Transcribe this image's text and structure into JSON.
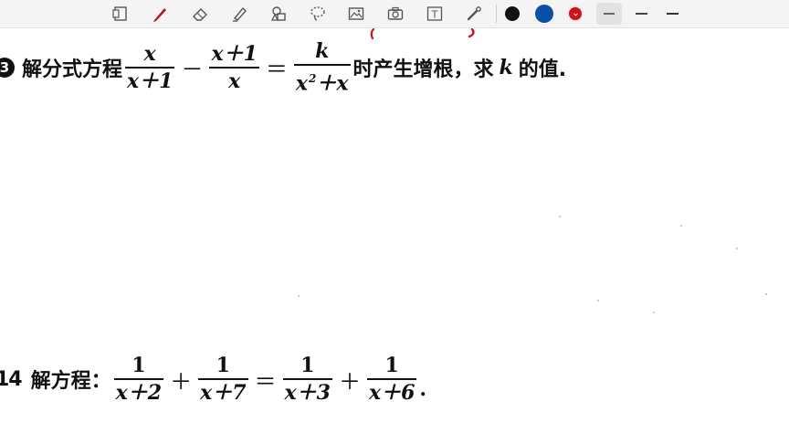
{
  "toolbar": {
    "tools": [
      {
        "name": "page-icon"
      },
      {
        "name": "pen-icon"
      },
      {
        "name": "eraser-icon"
      },
      {
        "name": "highlighter-icon"
      },
      {
        "name": "shapes-icon"
      },
      {
        "name": "lasso-icon"
      },
      {
        "name": "image-icon"
      },
      {
        "name": "camera-icon"
      },
      {
        "name": "text-icon"
      },
      {
        "name": "laser-pointer-icon"
      }
    ],
    "colors": [
      "#111111",
      "#0b4fa8",
      "#d0101a"
    ],
    "text_tool_glyph": "T",
    "line_widths": [
      "thin",
      "medium",
      "thick"
    ]
  },
  "problem13": {
    "number": "3",
    "prefix": "解分式方程",
    "f1_num": "x",
    "f1_den": "x＋1",
    "minus": "－",
    "f2_num": "x＋1",
    "f2_den": "x",
    "equals": "＝",
    "f3_num": "k",
    "f3_den_x": "x",
    "f3_den_exp": "2",
    "f3_den_rest": "＋x",
    "suffix_a": "时产生增根，求",
    "suffix_k": "k",
    "suffix_b": "的值."
  },
  "problem14": {
    "number": "14",
    "prefix": "解方程：",
    "fractions": [
      {
        "num": "1",
        "den": "x＋2"
      },
      {
        "num": "1",
        "den": "x＋7"
      },
      {
        "num": "1",
        "den": "x＋3"
      },
      {
        "num": "1",
        "den": "x＋6"
      }
    ],
    "plus": "＋",
    "equals": "＝",
    "end": "."
  },
  "annotation_color": "#d0101a"
}
